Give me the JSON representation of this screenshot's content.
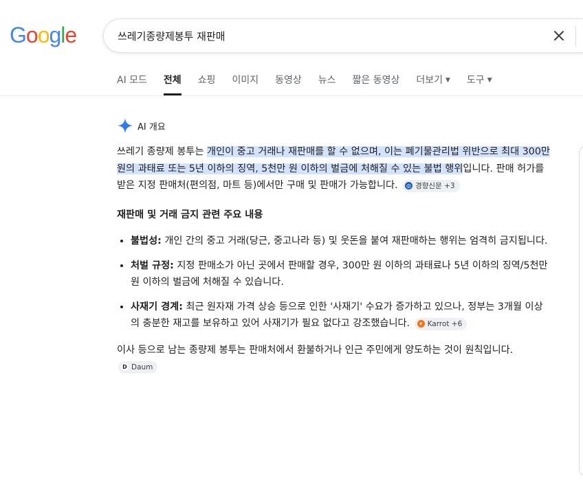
{
  "logo": {
    "letters": [
      "G",
      "o",
      "o",
      "g",
      "l",
      "e"
    ],
    "colors": [
      "#4285F4",
      "#EA4335",
      "#FBBC05",
      "#4285F4",
      "#34A853",
      "#EA4335"
    ]
  },
  "search": {
    "query": "쓰레기종량제봉투 재판매"
  },
  "tabs": [
    {
      "label": "AI 모드"
    },
    {
      "label": "전체"
    },
    {
      "label": "쇼핑"
    },
    {
      "label": "이미지"
    },
    {
      "label": "동영상"
    },
    {
      "label": "뉴스"
    },
    {
      "label": "짧은 동영상"
    },
    {
      "label": "더보기"
    },
    {
      "label": "도구"
    }
  ],
  "ai_overview": {
    "header": "AI 개요",
    "intro_plain_1": "쓰레기 종량제 봉투는 ",
    "intro_highlight": "개인이 중고 거래나 재판매를 할 수 없으며, 이는 폐기물관리법 위반으로 최대 300만 원의 과태료 또는 5년 이하의 징역, 5천만 원 이하의 벌금에 처해질 수 있는 불법 행위",
    "intro_plain_2": "입니다. 판매 허가를 받은 지정 판매처(편의점, 마트 등)에서만 구매 및 판매가 가능합니다.",
    "intro_source": "경향신문 +3",
    "section_title": "재판매 및 거래 금지 관련 주요 내용",
    "bullets": [
      {
        "title": "불법성:",
        "text": " 개인 간의 중고 거래(당근, 중고나라 등) 및 웃돈을 붙여 재판매하는 행위는 엄격히 금지됩니다.",
        "source": ""
      },
      {
        "title": "처벌 규정:",
        "text": " 지정 판매소가 아닌 곳에서 판매할 경우, 300만 원 이하의 과태료나 5년 이하의 징역/5천만 원 이하의 벌금에 처해질 수 있습니다.",
        "source": ""
      },
      {
        "title": "사재기 경계:",
        "text": " 최근 원자재 가격 상승 등으로 인한 '사재기' 수요가 증가하고 있으나, 정부는 3개월 이상의 충분한 재고를 보유하고 있어 사재기가 필요 없다고 강조했습니다.",
        "source": "Karrot +6"
      }
    ],
    "closing": "이사 등으로 남는 종량제 봉투는 판매처에서 환불하거나 인근 주민에게 양도하는 것이 원칙입니다.",
    "closing_source": "Daum"
  },
  "icons": {
    "clear": "close-icon",
    "ai": "sparkle-icon"
  },
  "colors": {
    "highlight": "#d3e3fd",
    "ai_blue": "#4285F4"
  }
}
